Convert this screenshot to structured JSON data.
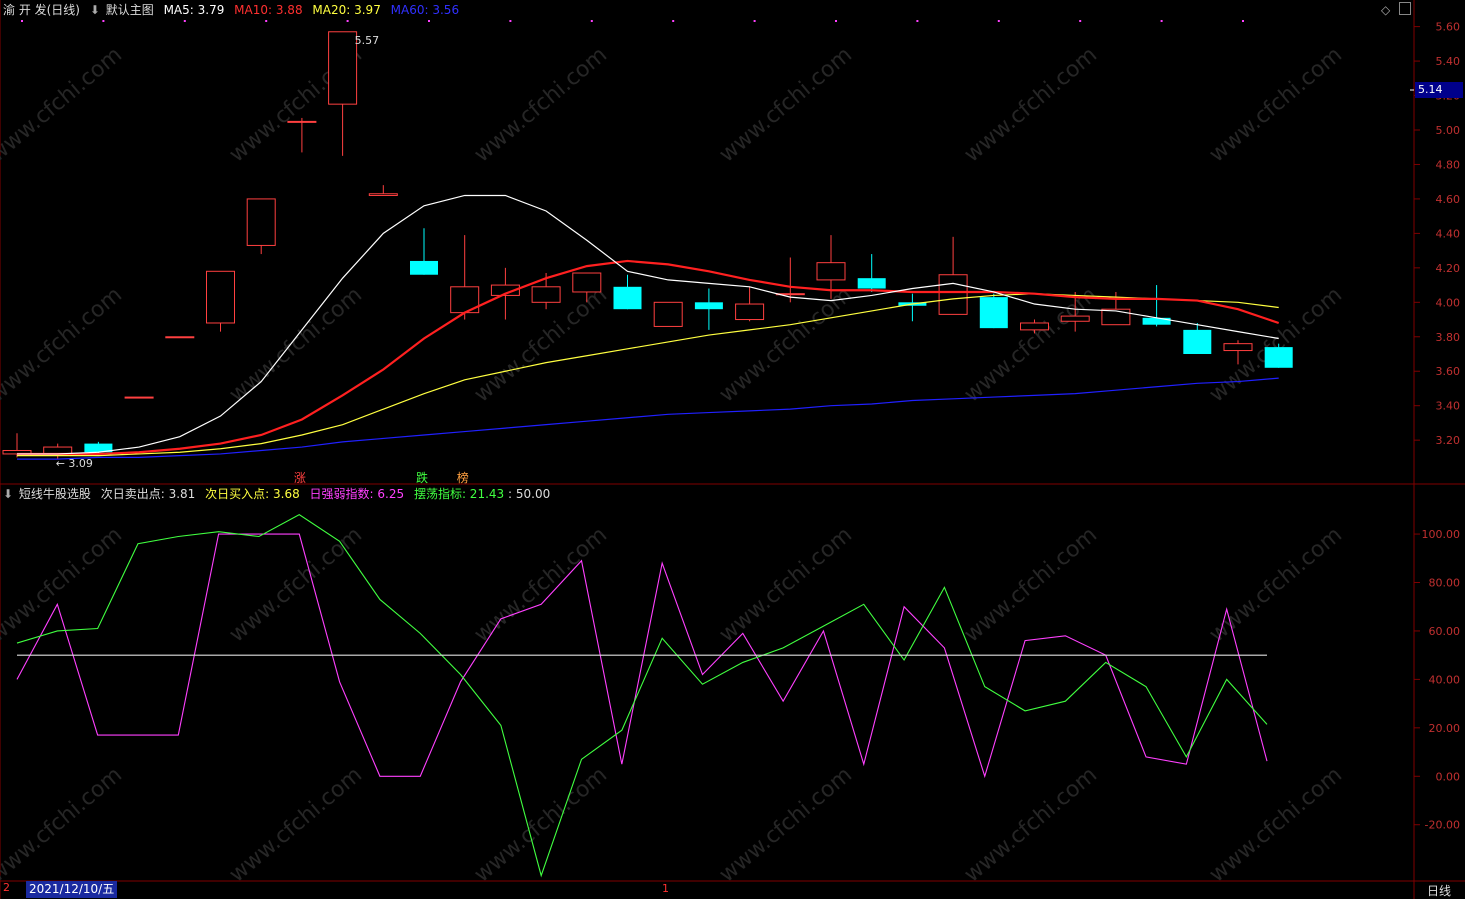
{
  "header": {
    "stock": "渝 开 发(日线)",
    "main_icon": "circle-chevron-icon",
    "main_label": "默认主图",
    "ma5": "MA5: 3.79",
    "ma10": "MA10: 3.88",
    "ma20": "MA20: 3.97",
    "ma60": "MA60: 3.56"
  },
  "indicator_header": {
    "title": "短线牛股选股",
    "sell": "次日卖出点: 3.81",
    "buy": "次日买入点: 3.68",
    "strength": "日强弱指数: 6.25",
    "swing": "摆荡指标: 21.43",
    "line": ": 50.00"
  },
  "labels": {
    "high": "5.57",
    "low": "3.09",
    "current_price": "5.14",
    "date": "2021/12/10/五",
    "period": "日线",
    "tick_mark": "1",
    "date_prefix": "2"
  },
  "markers": [
    {
      "text": "涨",
      "index": 7,
      "color": "#ff4040"
    },
    {
      "text": "跌",
      "index": 10,
      "color": "#40ff40"
    },
    {
      "text": "榜",
      "index": 11,
      "color": "#ffa040"
    }
  ],
  "watermark": "www.cfchi.com",
  "colors": {
    "up": "#ff4040",
    "down": "#00ffff",
    "ma5": "#ffffff",
    "ma10": "#ff2020",
    "ma20": "#ffff40",
    "ma60": "#2020ff",
    "strength": "#ff40ff",
    "swing": "#40ff40",
    "grid": "#800000"
  },
  "chart_data": [
    {
      "type": "candlestick",
      "x": [
        "1",
        "2",
        "3",
        "4",
        "5",
        "6",
        "7",
        "8",
        "9",
        "10",
        "11",
        "12",
        "13",
        "14",
        "15",
        "16",
        "17",
        "18",
        "19",
        "20",
        "21",
        "22",
        "23",
        "24",
        "25",
        "26",
        "27",
        "28",
        "29",
        "30",
        "31"
      ],
      "ohlc": [
        [
          3.12,
          3.24,
          3.1,
          3.14
        ],
        [
          3.12,
          3.18,
          3.09,
          3.16
        ],
        [
          3.18,
          3.19,
          3.12,
          3.13
        ],
        [
          3.45,
          3.45,
          3.45,
          3.45
        ],
        [
          3.8,
          3.8,
          3.8,
          3.8
        ],
        [
          3.88,
          4.18,
          3.83,
          4.18
        ],
        [
          4.33,
          4.6,
          4.28,
          4.6
        ],
        [
          5.05,
          5.07,
          4.87,
          5.05
        ],
        [
          5.15,
          5.57,
          4.85,
          5.57
        ],
        [
          4.62,
          4.68,
          4.62,
          4.63
        ],
        [
          4.24,
          4.43,
          4.16,
          4.16
        ],
        [
          3.94,
          4.39,
          3.9,
          4.09
        ],
        [
          4.04,
          4.2,
          3.9,
          4.1
        ],
        [
          4.0,
          4.17,
          3.96,
          4.09
        ],
        [
          4.06,
          4.17,
          4.0,
          4.17
        ],
        [
          4.09,
          4.16,
          3.96,
          3.96
        ],
        [
          3.86,
          4.0,
          3.86,
          4.0
        ],
        [
          4.0,
          4.08,
          3.84,
          3.96
        ],
        [
          3.9,
          4.09,
          3.89,
          3.99
        ],
        [
          4.05,
          4.26,
          4.0,
          4.05
        ],
        [
          4.13,
          4.39,
          4.02,
          4.23
        ],
        [
          4.14,
          4.28,
          4.06,
          4.08
        ],
        [
          4.0,
          4.05,
          3.89,
          3.98
        ],
        [
          3.93,
          4.38,
          3.93,
          4.16
        ],
        [
          4.03,
          4.05,
          3.85,
          3.85
        ],
        [
          3.84,
          3.9,
          3.82,
          3.88
        ],
        [
          3.89,
          4.06,
          3.83,
          3.92
        ],
        [
          3.87,
          4.06,
          3.87,
          3.96
        ],
        [
          3.91,
          4.1,
          3.86,
          3.87
        ],
        [
          3.84,
          3.88,
          3.7,
          3.7
        ],
        [
          3.72,
          3.78,
          3.64,
          3.76
        ],
        [
          3.74,
          3.76,
          3.62,
          3.62
        ]
      ],
      "ma5": [
        3.12,
        3.12,
        3.13,
        3.16,
        3.22,
        3.34,
        3.54,
        3.84,
        4.14,
        4.4,
        4.56,
        4.62,
        4.62,
        4.53,
        4.36,
        4.18,
        4.13,
        4.11,
        4.09,
        4.03,
        4.01,
        4.04,
        4.08,
        4.11,
        4.06,
        3.99,
        3.96,
        3.95,
        3.91,
        3.87,
        3.83,
        3.79
      ],
      "ma10": [
        3.12,
        3.12,
        3.12,
        3.13,
        3.15,
        3.18,
        3.23,
        3.32,
        3.46,
        3.61,
        3.79,
        3.94,
        4.05,
        4.14,
        4.21,
        4.24,
        4.22,
        4.18,
        4.13,
        4.09,
        4.07,
        4.07,
        4.06,
        4.06,
        4.06,
        4.05,
        4.03,
        4.02,
        4.02,
        4.01,
        3.96,
        3.88
      ],
      "ma20": [
        3.11,
        3.11,
        3.11,
        3.12,
        3.13,
        3.15,
        3.18,
        3.23,
        3.29,
        3.38,
        3.47,
        3.55,
        3.6,
        3.65,
        3.69,
        3.73,
        3.77,
        3.81,
        3.84,
        3.87,
        3.91,
        3.95,
        3.99,
        4.02,
        4.04,
        4.05,
        4.04,
        4.03,
        4.02,
        4.01,
        4.0,
        3.97
      ],
      "ma60": [
        3.09,
        3.09,
        3.1,
        3.1,
        3.11,
        3.12,
        3.14,
        3.16,
        3.19,
        3.21,
        3.23,
        3.25,
        3.27,
        3.29,
        3.31,
        3.33,
        3.35,
        3.36,
        3.37,
        3.38,
        3.4,
        3.41,
        3.43,
        3.44,
        3.45,
        3.46,
        3.47,
        3.49,
        3.51,
        3.53,
        3.54,
        3.56
      ],
      "ylim": [
        3.05,
        5.65
      ],
      "yticks": [
        3.2,
        3.4,
        3.6,
        3.8,
        4.0,
        4.2,
        4.4,
        4.6,
        4.8,
        5.0,
        5.2,
        5.4,
        5.6
      ],
      "grid": false
    },
    {
      "type": "line",
      "x": [
        "1",
        "2",
        "3",
        "4",
        "5",
        "6",
        "7",
        "8",
        "9",
        "10",
        "11",
        "12",
        "13",
        "14",
        "15",
        "16",
        "17",
        "18",
        "19",
        "20",
        "21",
        "22",
        "23",
        "24",
        "25",
        "26",
        "27",
        "28",
        "29",
        "30",
        "31",
        "32"
      ],
      "series": [
        {
          "name": "日强弱指数",
          "values": [
            40,
            71,
            17,
            17,
            17,
            100,
            100,
            100,
            39,
            0,
            0,
            39,
            65,
            71,
            89,
            5,
            88,
            42,
            59,
            31,
            60,
            5,
            70,
            53,
            0,
            56,
            58,
            50,
            8,
            5,
            69,
            6.25
          ]
        },
        {
          "name": "摆荡指标",
          "values": [
            55,
            60,
            61,
            96,
            99,
            101,
            99,
            108,
            97,
            73,
            59,
            42,
            21,
            -41,
            7,
            19,
            57,
            38,
            47,
            53,
            62,
            71,
            48,
            78,
            37,
            27,
            31,
            47,
            37,
            8,
            40,
            21.43
          ]
        },
        {
          "name": "",
          "values": [
            50,
            50,
            50,
            50,
            50,
            50,
            50,
            50,
            50,
            50,
            50,
            50,
            50,
            50,
            50,
            50,
            50,
            50,
            50,
            50,
            50,
            50,
            50,
            50,
            50,
            50,
            50,
            50,
            50,
            50,
            50,
            50
          ]
        }
      ],
      "ylim": [
        -42,
        112
      ],
      "yticks": [
        -20,
        0,
        20,
        40,
        60,
        80,
        100
      ],
      "ytick_labels": [
        "-20.00",
        "0.00",
        "20.00",
        "40.00",
        "60.00",
        "80.00",
        "100.00"
      ],
      "grid": false
    }
  ]
}
